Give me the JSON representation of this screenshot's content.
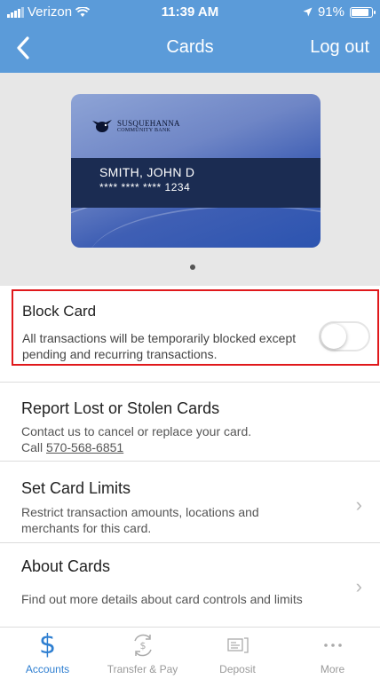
{
  "status_bar": {
    "carrier": "Verizon",
    "time": "11:39 AM",
    "battery": "91%"
  },
  "nav": {
    "title": "Cards",
    "logout_label": "Log out"
  },
  "card": {
    "brand_line1": "SUSQUEHANNA",
    "brand_line2": "COMMUNITY BANK",
    "holder_name": "SMITH, JOHN D",
    "number_masked": "**** **** **** 1234"
  },
  "block_card": {
    "title": "Block Card",
    "description": "All transactions will be temporarily blocked except pending and recurring transactions.",
    "enabled": false
  },
  "report": {
    "title": "Report Lost or Stolen Cards",
    "line1": "Contact us to cancel or replace your card.",
    "call_label": "Call",
    "phone": "570-568-6851"
  },
  "limits": {
    "title": "Set Card Limits",
    "description": "Restrict transaction amounts, locations and merchants for this card."
  },
  "about": {
    "title": "About Cards",
    "description": "Find out more details about card controls and limits"
  },
  "tabs": [
    {
      "label": "Accounts",
      "icon": "dollar-icon",
      "active": true
    },
    {
      "label": "Transfer & Pay",
      "icon": "transfer-icon",
      "active": false
    },
    {
      "label": "Deposit",
      "icon": "deposit-icon",
      "active": false
    },
    {
      "label": "More",
      "icon": "more-icon",
      "active": false
    }
  ],
  "colors": {
    "header": "#5b9bd9",
    "accent": "#2f7fd1",
    "highlight_border": "#e0181b"
  }
}
